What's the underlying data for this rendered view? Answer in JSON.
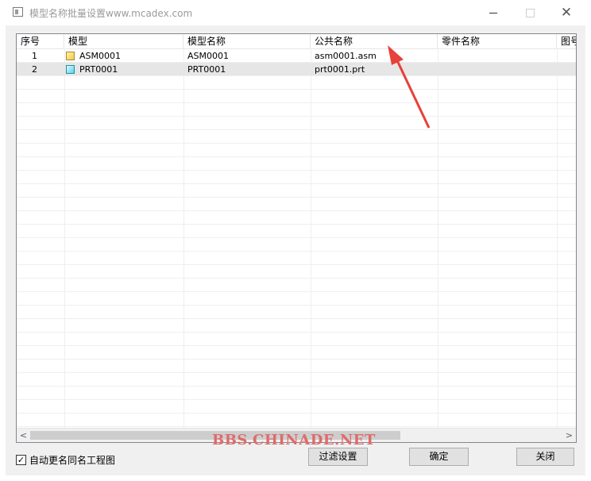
{
  "window": {
    "title": "模型名称批量设置www.mcadex.com",
    "icon": "app-icon",
    "controls": {
      "minimize_icon": "minimize-icon",
      "maximize_icon": "maximize-icon",
      "close_icon": "close-icon",
      "close_glyph": "✕"
    }
  },
  "table": {
    "columns": [
      "序号",
      "模型",
      "模型名称",
      "公共名称",
      "零件名称",
      "图号"
    ],
    "rows": [
      {
        "index": "1",
        "model": "ASM0001",
        "model_icon": "assembly-icon",
        "model_name": "ASM0001",
        "common_name": "asm0001.asm",
        "part_name": "",
        "drawing_no": ""
      },
      {
        "index": "2",
        "model": "PRT0001",
        "model_icon": "part-icon",
        "model_name": "PRT0001",
        "common_name": "prt0001.prt",
        "part_name": "",
        "drawing_no": ""
      }
    ]
  },
  "scrollbar": {
    "left_arrow": "<",
    "right_arrow": ">"
  },
  "footer": {
    "auto_rename_checkbox": {
      "label": "自动更名同名工程图",
      "checked": true,
      "check_glyph": "✓"
    },
    "filter_button": "过滤设置",
    "ok_button": "确定",
    "close_button": "关闭"
  },
  "watermark": "BBS.CHINADE.NET",
  "colors": {
    "arrow": "#e8403a",
    "watermark": "#e06a6a",
    "selected_row": "#e6e6e6",
    "dialog_bg": "#f0f0f0"
  }
}
